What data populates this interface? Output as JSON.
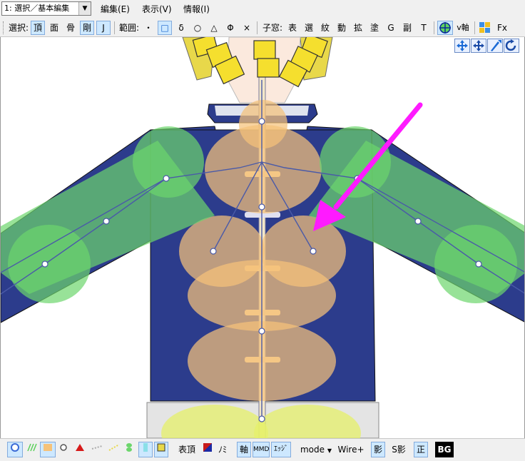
{
  "menubar": {
    "mode_select": "1: 選択／基本編集",
    "items": [
      "編集(E)",
      "表示(V)",
      "情報(I)"
    ]
  },
  "toolbar": {
    "select_label": "選択:",
    "select_vertex": "頂",
    "select_face": "面",
    "select_bone": "骨",
    "select_rigid": "剛",
    "select_joint": "J",
    "range_label": "範囲:",
    "range_point": "・",
    "range_rect": "□",
    "range_delta": "δ",
    "range_circle": "○",
    "range_triangle": "△",
    "range_phi": "Φ",
    "range_x": "×",
    "subwindow_label": "子窓:",
    "sw_items": [
      "表",
      "選",
      "紋",
      "動",
      "拡",
      "塗",
      "G",
      "副",
      "T"
    ],
    "v_axis": "v軸",
    "fx": "Fx"
  },
  "bottombar": {
    "vertex_table": "表頂",
    "no_label": "ﾉﾐ",
    "axis": "軸",
    "mmd": "MMD",
    "edge": "ｴｯｼﾞ",
    "mode": "mode",
    "wire": "Wire+",
    "shadow": "影",
    "s_shadow": "S影",
    "ortho": "正",
    "bg": "BG"
  },
  "colors": {
    "accent": "#cde8ff",
    "rigid_green": "#6cd66c",
    "rigid_orange": "#f5c27a",
    "shirt_navy": "#2c3c8c",
    "arrow_magenta": "#ff1aff"
  }
}
